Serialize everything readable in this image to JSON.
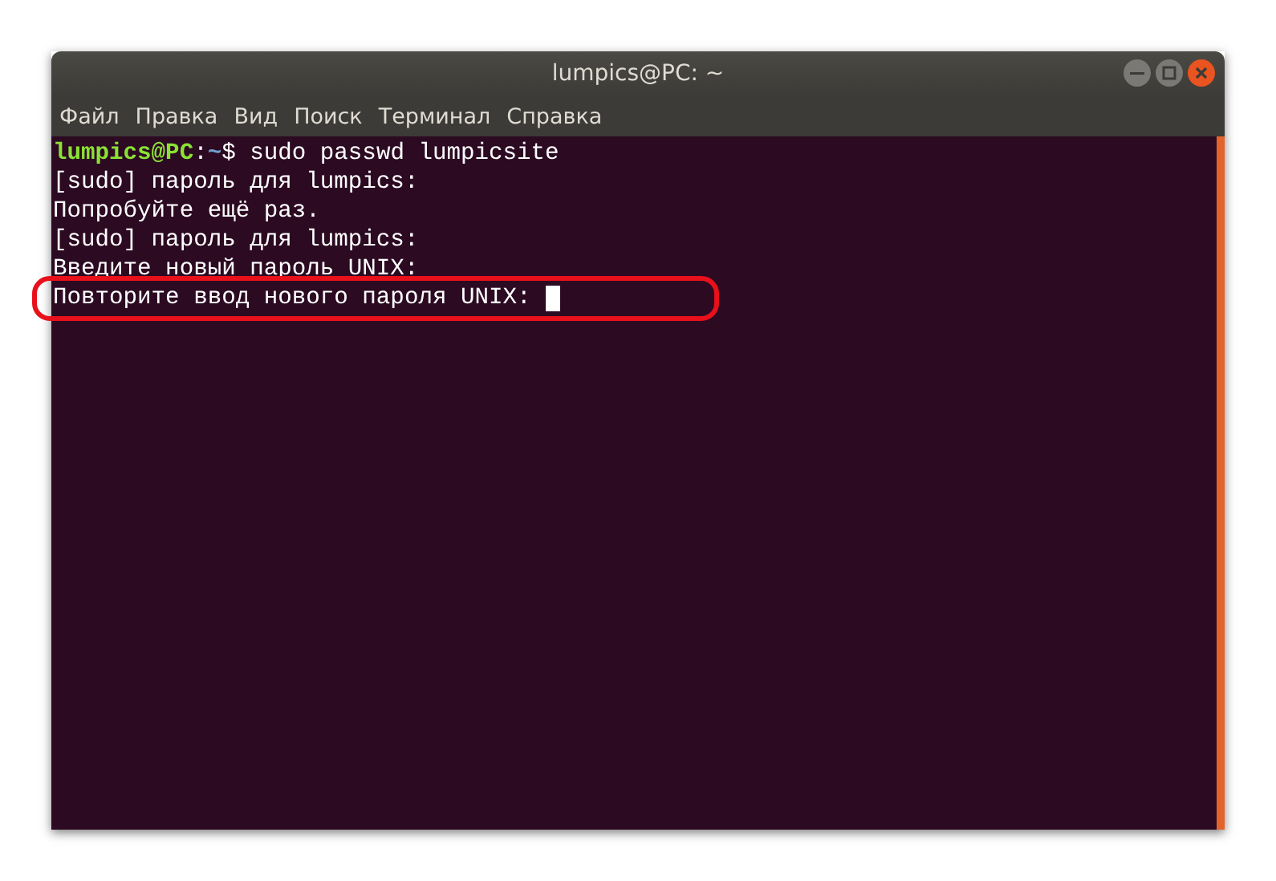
{
  "window": {
    "title": "lumpics@PC: ~"
  },
  "menu": [
    "Файл",
    "Правка",
    "Вид",
    "Поиск",
    "Терминал",
    "Справка"
  ],
  "terminal": {
    "lines": [
      {
        "highlighted": false,
        "cursor": false,
        "segments": [
          {
            "kind": "user",
            "text": "lumpics@PC"
          },
          {
            "kind": "plain",
            "text": ":"
          },
          {
            "kind": "path",
            "text": "~"
          },
          {
            "kind": "plain",
            "text": "$ sudo passwd lumpicsite"
          }
        ]
      },
      {
        "highlighted": false,
        "cursor": false,
        "segments": [
          {
            "kind": "plain",
            "text": "[sudo] пароль для lumpics:"
          }
        ]
      },
      {
        "highlighted": false,
        "cursor": false,
        "segments": [
          {
            "kind": "plain",
            "text": "Попробуйте ещё раз."
          }
        ]
      },
      {
        "highlighted": false,
        "cursor": false,
        "segments": [
          {
            "kind": "plain",
            "text": "[sudo] пароль для lumpics:"
          }
        ]
      },
      {
        "highlighted": false,
        "cursor": false,
        "segments": [
          {
            "kind": "plain",
            "text": "Введите новый пароль UNIX:"
          }
        ]
      },
      {
        "highlighted": true,
        "cursor": true,
        "segments": [
          {
            "kind": "plain",
            "text": "Повторите ввод нового пароля UNIX: "
          }
        ]
      }
    ]
  }
}
